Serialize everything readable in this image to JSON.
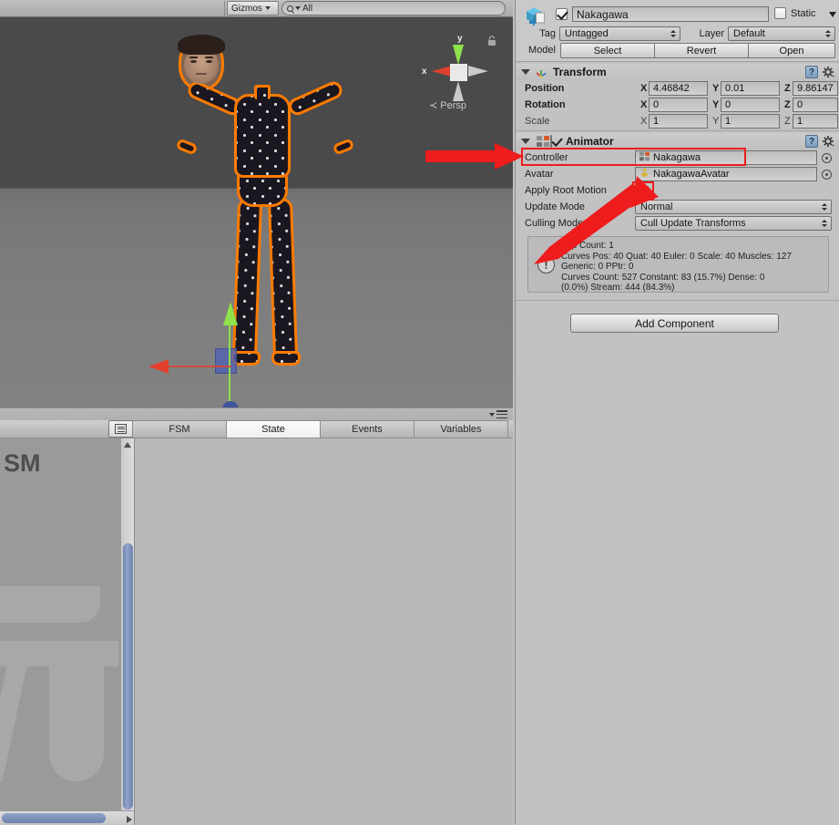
{
  "scene": {
    "toolbar": {
      "gizmos_label": "Gizmos",
      "search_value": "All",
      "search_icon": "search-icon"
    },
    "view_gizmo": {
      "axis_y": "y",
      "axis_x": "x",
      "perspective_label": "Persp",
      "lock_icon": "lock-icon"
    }
  },
  "bottom_panel": {
    "icon_button": "layout-icon",
    "menu_icon": "panel-menu-icon",
    "tabs": [
      {
        "label": "FSM",
        "active": false
      },
      {
        "label": "State",
        "active": true
      },
      {
        "label": "Events",
        "active": false
      },
      {
        "label": "Variables",
        "active": false
      }
    ],
    "graph_watermark_text": "SM"
  },
  "inspector": {
    "object_icon": "prefab-cube-icon",
    "name_enabled": true,
    "name": "Nakagawa",
    "static_label": "Static",
    "static_enabled": false,
    "tag_label": "Tag",
    "tag_value": "Untagged",
    "layer_label": "Layer",
    "layer_value": "Default",
    "model_label": "Model",
    "model_buttons": [
      "Select",
      "Revert",
      "Open"
    ],
    "transform": {
      "icon": "transform-axis-icon",
      "title": "Transform",
      "help_icon": "help-book-icon",
      "gear_icon": "gear-icon",
      "rows": [
        {
          "name": "Position",
          "x": "4.46842",
          "y": "0.01",
          "z": "9.86147",
          "dim": false
        },
        {
          "name": "Rotation",
          "x": "0",
          "y": "0",
          "z": "0",
          "dim": false
        },
        {
          "name": "Scale",
          "x": "1",
          "y": "1",
          "z": "1",
          "dim": true
        }
      ],
      "axis_labels": {
        "x": "X",
        "y": "Y",
        "z": "Z"
      }
    },
    "animator": {
      "icon": "animator-icon",
      "title": "Animator",
      "enabled": true,
      "help_icon": "help-book-icon",
      "gear_icon": "gear-icon",
      "controller_label": "Controller",
      "controller_value": "Nakagawa",
      "controller_icon": "animator-controller-icon",
      "avatar_label": "Avatar",
      "avatar_value": "NakagawaAvatar",
      "avatar_icon": "avatar-icon",
      "apply_root_motion_label": "Apply Root Motion",
      "apply_root_motion_enabled": true,
      "update_mode_label": "Update Mode",
      "update_mode_value": "Normal",
      "culling_mode_label": "Culling Mode",
      "culling_mode_value": "Cull Update Transforms",
      "info_icon": "info-exclamation-icon",
      "info_text": "Clip Count: 1\nCurves Pos: 40 Quat: 40 Euler: 0 Scale: 40 Muscles: 127\nGeneric: 0 PPtr: 0\nCurves Count: 527 Constant: 83 (15.7%) Dense: 0\n(0.0%) Stream: 444 (84.3%)"
    },
    "add_component_label": "Add Component"
  },
  "annotations": {
    "accent_color": "#ee1c1c",
    "arrow_to_controller": "red-arrow-right",
    "arrow_to_root_motion": "red-arrow-up-right",
    "highlight_controller_field": true,
    "highlight_root_motion_checkbox": true
  }
}
